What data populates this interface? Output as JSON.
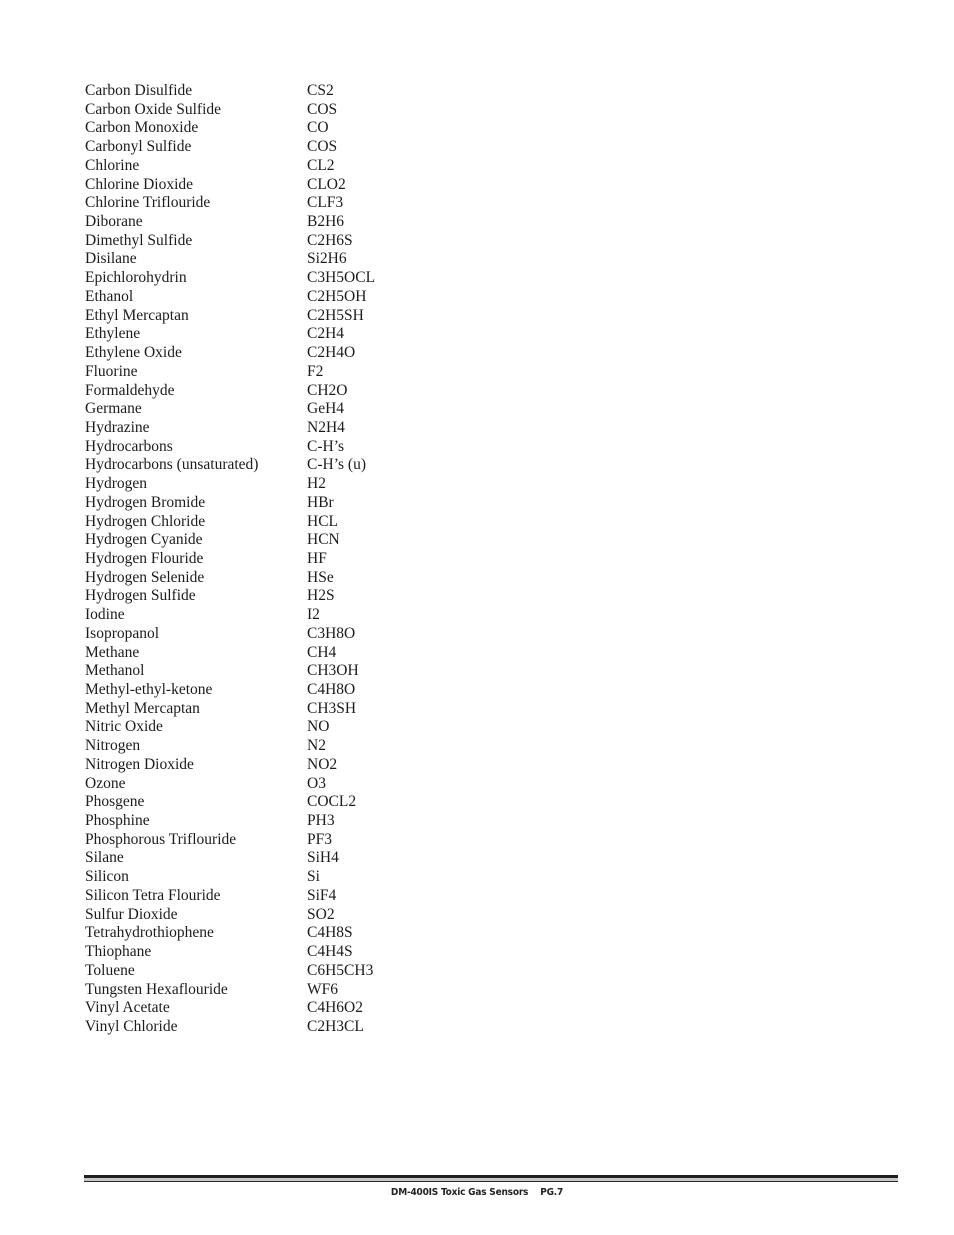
{
  "gases": [
    {
      "name": "Carbon Disulfide",
      "formula": "CS2"
    },
    {
      "name": "Carbon Oxide Sulfide",
      "formula": "COS"
    },
    {
      "name": "Carbon Monoxide",
      "formula": "CO"
    },
    {
      "name": "Carbonyl Sulfide",
      "formula": "COS"
    },
    {
      "name": "Chlorine",
      "formula": "CL2"
    },
    {
      "name": "Chlorine Dioxide",
      "formula": "CLO2"
    },
    {
      "name": "Chlorine Triflouride",
      "formula": "CLF3"
    },
    {
      "name": "Diborane",
      "formula": "B2H6"
    },
    {
      "name": "Dimethyl Sulfide",
      "formula": "C2H6S"
    },
    {
      "name": "Disilane",
      "formula": "Si2H6"
    },
    {
      "name": "Epichlorohydrin",
      "formula": "C3H5OCL"
    },
    {
      "name": "Ethanol",
      "formula": "C2H5OH"
    },
    {
      "name": "Ethyl Mercaptan",
      "formula": "C2H5SH"
    },
    {
      "name": "Ethylene",
      "formula": "C2H4"
    },
    {
      "name": "Ethylene Oxide",
      "formula": "C2H4O"
    },
    {
      "name": "Fluorine",
      "formula": "F2"
    },
    {
      "name": "Formaldehyde",
      "formula": "CH2O"
    },
    {
      "name": "Germane",
      "formula": "GeH4"
    },
    {
      "name": "Hydrazine",
      "formula": "N2H4"
    },
    {
      "name": "Hydrocarbons",
      "formula": "C-H’s"
    },
    {
      "name": "Hydrocarbons (unsaturated)",
      "formula": "C-H’s (u)"
    },
    {
      "name": "Hydrogen",
      "formula": "H2"
    },
    {
      "name": "Hydrogen Bromide",
      "formula": "HBr"
    },
    {
      "name": "Hydrogen Chloride",
      "formula": "HCL"
    },
    {
      "name": "Hydrogen Cyanide",
      "formula": "HCN"
    },
    {
      "name": "Hydrogen Flouride",
      "formula": "HF"
    },
    {
      "name": "Hydrogen Selenide",
      "formula": "HSe"
    },
    {
      "name": "Hydrogen Sulfide",
      "formula": "H2S"
    },
    {
      "name": "Iodine",
      "formula": "I2"
    },
    {
      "name": "Isopropanol",
      "formula": "C3H8O"
    },
    {
      "name": "Methane",
      "formula": "CH4"
    },
    {
      "name": "Methanol",
      "formula": "CH3OH"
    },
    {
      "name": "Methyl-ethyl-ketone",
      "formula": "C4H8O"
    },
    {
      "name": "Methyl Mercaptan",
      "formula": "CH3SH"
    },
    {
      "name": "Nitric Oxide",
      "formula": "NO"
    },
    {
      "name": "Nitrogen",
      "formula": "N2"
    },
    {
      "name": "Nitrogen Dioxide",
      "formula": "NO2"
    },
    {
      "name": "Ozone",
      "formula": "O3"
    },
    {
      "name": "Phosgene",
      "formula": "COCL2"
    },
    {
      "name": "Phosphine",
      "formula": "PH3"
    },
    {
      "name": "Phosphorous Triflouride",
      "formula": "PF3"
    },
    {
      "name": "Silane",
      "formula": "SiH4"
    },
    {
      "name": "Silicon",
      "formula": "Si"
    },
    {
      "name": "Silicon Tetra Flouride",
      "formula": "SiF4"
    },
    {
      "name": "Sulfur Dioxide",
      "formula": "SO2"
    },
    {
      "name": "Tetrahydrothiophene",
      "formula": "C4H8S"
    },
    {
      "name": "Thiophane",
      "formula": "C4H4S"
    },
    {
      "name": "Toluene",
      "formula": "C6H5CH3"
    },
    {
      "name": "Tungsten Hexaflouride",
      "formula": "WF6"
    },
    {
      "name": "Vinyl Acetate",
      "formula": "C4H6O2"
    },
    {
      "name": "Vinyl Chloride",
      "formula": "C2H3CL"
    }
  ],
  "footer": {
    "title": "DM-400IS Toxic Gas Sensors",
    "page": "PG.7"
  }
}
